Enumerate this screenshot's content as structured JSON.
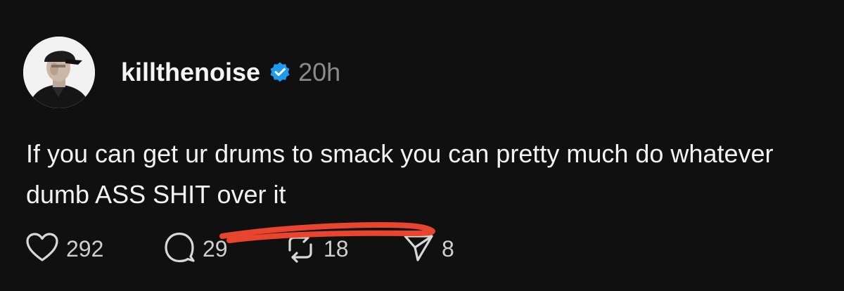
{
  "post": {
    "username": "killthenoise",
    "timestamp": "20h",
    "text": "If you can get ur drums to smack you can pretty much do whatever dumb ASS SHIT over it",
    "verified_color": "#1D9BF0"
  },
  "actions": {
    "likes": "292",
    "comments": "29",
    "reposts": "18",
    "shares": "8"
  },
  "icons": {
    "avatar": "avatar",
    "verified": "verified-badge-icon",
    "like": "heart-icon",
    "comment": "comment-bubble-icon",
    "repost": "repost-icon",
    "share": "send-icon"
  },
  "annotation_color": "#E8442E"
}
